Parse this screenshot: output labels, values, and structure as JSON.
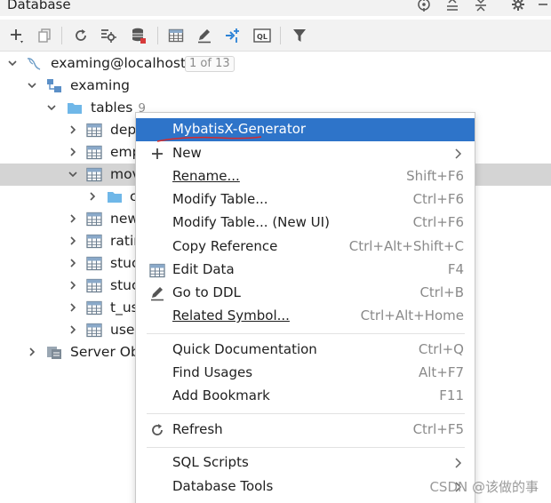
{
  "panel": {
    "title": "Database"
  },
  "toolbar": {
    "buttons": [
      {
        "name": "add-icon"
      },
      {
        "name": "copy-icon"
      },
      {
        "name": "refresh-icon"
      },
      {
        "name": "schema-settings-icon"
      },
      {
        "name": "stop-database-icon"
      },
      {
        "name": "table-view-icon"
      },
      {
        "name": "edit-icon"
      },
      {
        "name": "jump-to-source-icon"
      },
      {
        "name": "sql-console-icon"
      },
      {
        "name": "filter-icon"
      }
    ],
    "console_label": "QL"
  },
  "tree": {
    "connection": {
      "label": "examing@localhost",
      "badge": "1 of 13"
    },
    "schema": {
      "label": "examing"
    },
    "tables_folder": {
      "label": "tables",
      "count": "9"
    },
    "tables": [
      {
        "label": "dep"
      },
      {
        "label": "emp"
      },
      {
        "label": "mov"
      },
      {
        "label": "c"
      },
      {
        "label": "new"
      },
      {
        "label": "ratir"
      },
      {
        "label": "stuc"
      },
      {
        "label": "stuc"
      },
      {
        "label": "t_us"
      },
      {
        "label": "user"
      }
    ],
    "server_objects": {
      "label": "Server Ob"
    }
  },
  "context_menu": {
    "items": [
      {
        "label": "MybatisX-Generator",
        "highlighted": true
      },
      {
        "label": "New",
        "icon": "plus-icon",
        "submenu": true
      },
      {
        "label": "Rename...",
        "shortcut": "Shift+F6"
      },
      {
        "label": "Modify Table...",
        "shortcut": "Ctrl+F6"
      },
      {
        "label": "Modify Table... (New UI)",
        "shortcut": "Ctrl+F6"
      },
      {
        "label": "Copy Reference",
        "shortcut": "Ctrl+Alt+Shift+C"
      },
      {
        "label": "Edit Data",
        "icon": "table-icon",
        "shortcut": "F4"
      },
      {
        "label": "Go to DDL",
        "icon": "pencil-icon",
        "shortcut": "Ctrl+B"
      },
      {
        "label": "Related Symbol...",
        "shortcut": "Ctrl+Alt+Home"
      },
      {
        "label": "Quick Documentation",
        "shortcut": "Ctrl+Q"
      },
      {
        "label": "Find Usages",
        "shortcut": "Alt+F7"
      },
      {
        "label": "Add Bookmark",
        "shortcut": "F11"
      },
      {
        "label": "Refresh",
        "icon": "refresh-icon",
        "shortcut": "Ctrl+F5"
      },
      {
        "label": "SQL Scripts",
        "submenu": true
      },
      {
        "label": "Database Tools",
        "submenu": true
      }
    ]
  },
  "watermark": "CSDN @该做的事",
  "colors": {
    "highlight": "#2e74c9",
    "selected_row": "#d4d4d4",
    "folder": "#6fb7e8",
    "annotation_red": "#d62b2b"
  }
}
